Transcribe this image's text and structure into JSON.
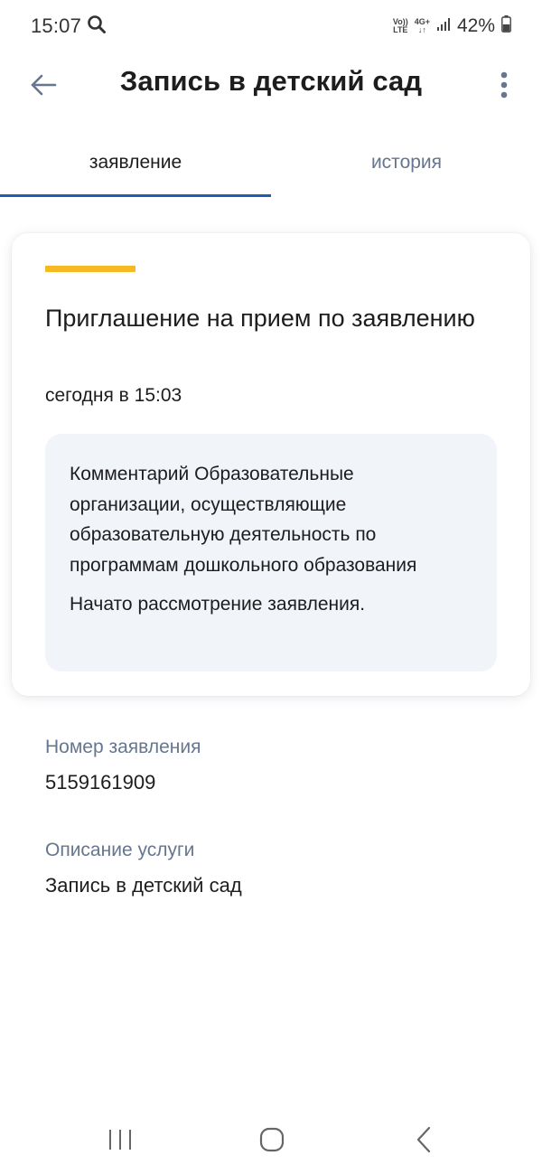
{
  "status_bar": {
    "time": "15:07",
    "network_top": "Vo)) 4G+",
    "network_lte": "LTE",
    "battery": "42%"
  },
  "app_bar": {
    "title": "Запись в детский сад",
    "back_icon": "arrow-left-icon",
    "more_icon": "more-vertical-icon"
  },
  "tabs": [
    {
      "label": "заявление",
      "active": true
    },
    {
      "label": "история",
      "active": false
    }
  ],
  "card": {
    "title": "Приглашение на прием по заявлению",
    "date": "сегодня в 15:03",
    "comment_title": "Комментарий Образовательные организации, осуществляющие образовательную деятельность по программам дошкольного образования",
    "comment_text": "Начато рассмотрение заявления."
  },
  "fields": [
    {
      "label": "Номер заявления",
      "value": "5159161909"
    },
    {
      "label": "Описание услуги",
      "value": "Запись в детский сад"
    }
  ],
  "colors": {
    "accent": "#1e5db3",
    "highlight": "#f6b823",
    "muted_text": "#66768e",
    "comment_bg": "#f1f4f9"
  },
  "nav_bar": {
    "recents_icon": "recents-icon",
    "home_icon": "home-icon",
    "back_icon": "chevron-left-icon"
  }
}
